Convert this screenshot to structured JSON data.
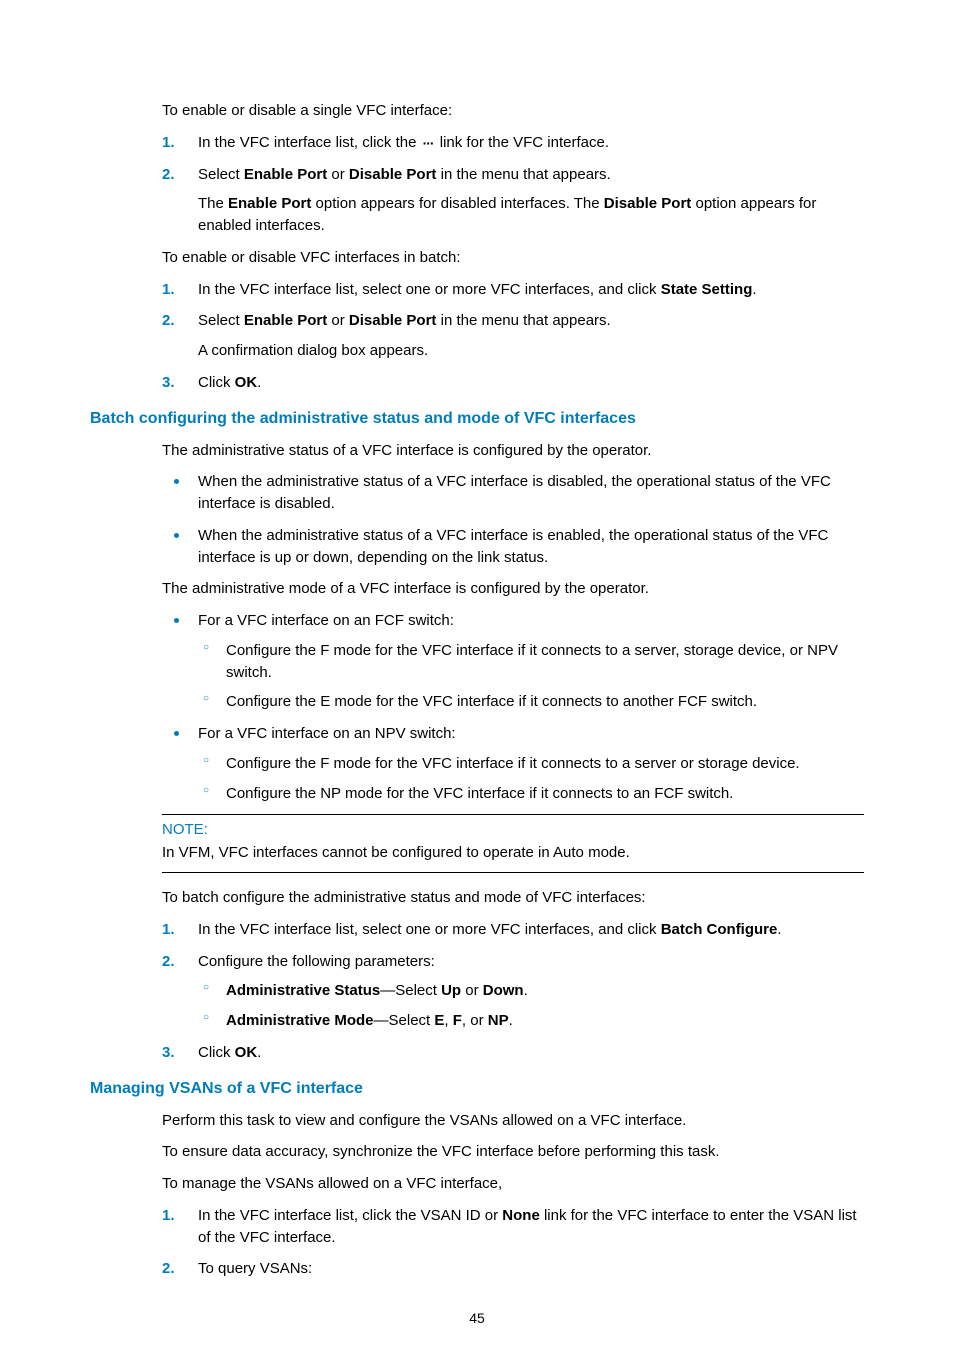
{
  "intro1": "To enable or disable a single VFC interface:",
  "list1": {
    "s1a": "In the VFC interface list, click the ",
    "s1b": " link for the VFC interface.",
    "icon_dots": "···",
    "s2a": "Select ",
    "s2b": "Enable Port",
    "s2c": " or ",
    "s2d": "Disable Port",
    "s2e": " in the menu that appears.",
    "s2note_a": "The ",
    "s2note_b": "Enable Port",
    "s2note_c": " option appears for disabled interfaces. The ",
    "s2note_d": "Disable Port",
    "s2note_e": " option appears for enabled interfaces."
  },
  "intro2": "To enable or disable VFC interfaces in batch:",
  "list2": {
    "s1a": "In the VFC interface list, select one or more VFC interfaces, and click ",
    "s1b": "State Setting",
    "s1c": ".",
    "s2a": "Select ",
    "s2b": "Enable Port",
    "s2c": " or ",
    "s2d": "Disable Port",
    "s2e": " in the menu that appears.",
    "s2note": "A confirmation dialog box appears.",
    "s3a": "Click ",
    "s3b": "OK",
    "s3c": "."
  },
  "heading1": "Batch configuring the administrative status and mode of VFC interfaces",
  "sec1": {
    "p1": "The administrative status of a VFC interface is configured by the operator.",
    "b1": "When the administrative status of a VFC interface is disabled, the operational status of the VFC interface is disabled.",
    "b2": "When the administrative status of a VFC interface is enabled, the operational status of the VFC interface is up or down, depending on the link status.",
    "p2": "The administrative mode of a VFC interface is configured by the operator.",
    "b3": "For a VFC interface on an FCF switch:",
    "b3s1": "Configure the F mode for the VFC interface if it connects to a server, storage device, or NPV switch.",
    "b3s2": "Configure the E mode for the VFC interface if it connects to another FCF switch.",
    "b4": "For a VFC interface on an NPV switch:",
    "b4s1": "Configure the F mode for the VFC interface if it connects to a server or storage device.",
    "b4s2": "Configure the NP mode for the VFC interface if it connects to an FCF switch."
  },
  "note": {
    "label": "NOTE:",
    "text": "In VFM, VFC interfaces cannot be configured to operate in Auto mode."
  },
  "intro3": "To batch configure the administrative status and mode of VFC interfaces:",
  "list3": {
    "s1a": "In the VFC interface list, select one or more VFC interfaces, and click ",
    "s1b": "Batch Configure",
    "s1c": ".",
    "s2": "Configure the following parameters:",
    "s2s1_a": "Administrative Status",
    "s2s1_b": "—Select ",
    "s2s1_c": "Up",
    "s2s1_d": " or ",
    "s2s1_e": "Down",
    "s2s1_f": ".",
    "s2s2_a": "Administrative Mode",
    "s2s2_b": "—Select ",
    "s2s2_c": "E",
    "s2s2_d": ", ",
    "s2s2_e": "F",
    "s2s2_f": ", or ",
    "s2s2_g": "NP",
    "s2s2_h": ".",
    "s3a": "Click ",
    "s3b": "OK",
    "s3c": "."
  },
  "heading2": "Managing VSANs of a VFC interface",
  "sec2": {
    "p1": "Perform this task to view and configure the VSANs allowed on a VFC interface.",
    "p2": "To ensure data accuracy, synchronize the VFC interface before performing this task.",
    "p3": "To manage the VSANs allowed on a VFC interface,"
  },
  "list4": {
    "s1a": "In the VFC interface list, click the VSAN ID or ",
    "s1b": "None",
    "s1c": " link for the VFC interface to enter the VSAN list of the VFC interface.",
    "s2": "To query VSANs:"
  },
  "page_number": "45"
}
